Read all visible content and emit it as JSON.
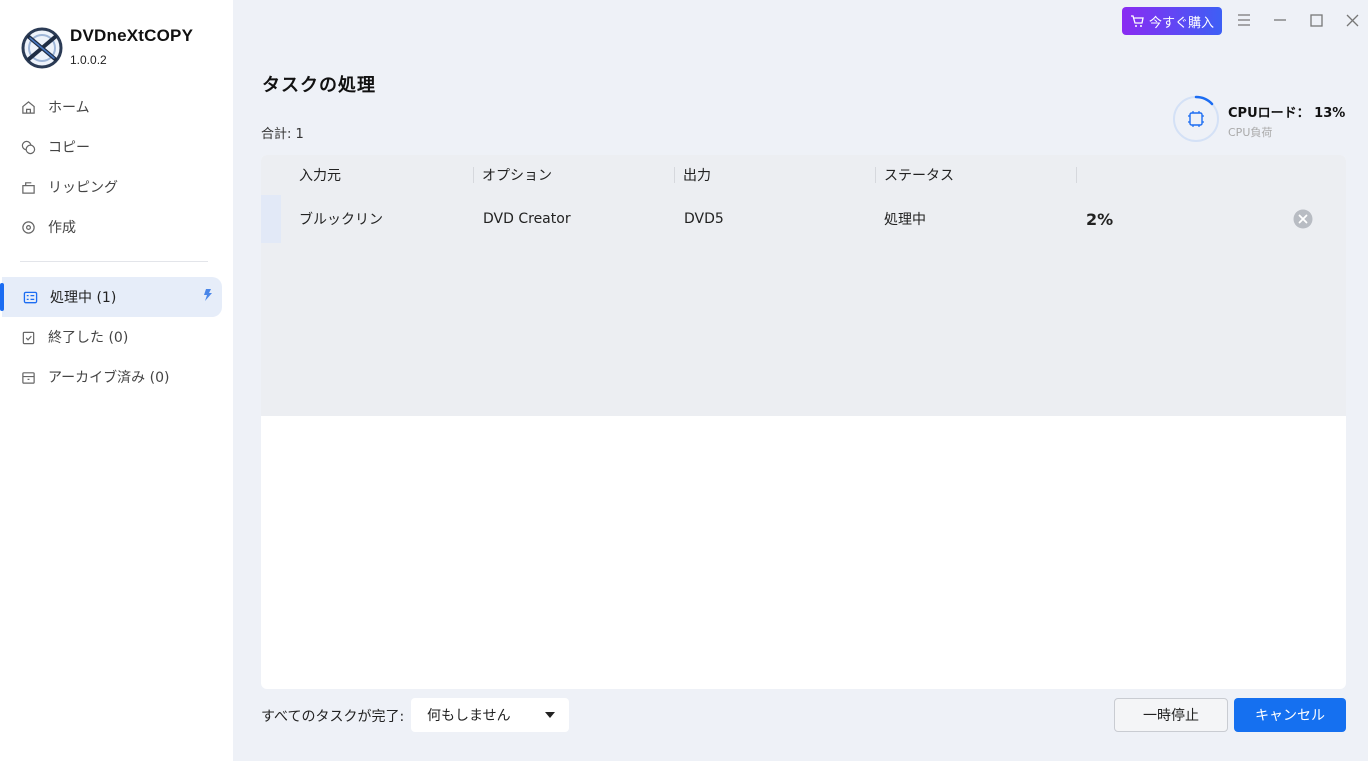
{
  "app": {
    "title": "DVDneXtCOPY",
    "version": "1.0.0.2"
  },
  "topbar": {
    "buy_label": "今すぐ購入",
    "accent_gradient": [
      "#8a2bf2",
      "#3d5ff5"
    ]
  },
  "sidebar": {
    "items": [
      {
        "label": "ホーム",
        "icon": "home-icon"
      },
      {
        "label": "コピー",
        "icon": "copy-icon"
      },
      {
        "label": "リッピング",
        "icon": "ripping-icon"
      },
      {
        "label": "作成",
        "icon": "create-icon"
      },
      {
        "label": "処理中 (1)",
        "icon": "processing-icon",
        "active": true
      },
      {
        "label": "終了した (0)",
        "icon": "finished-icon"
      },
      {
        "label": "アーカイブ済み (0)",
        "icon": "archive-icon"
      }
    ]
  },
  "main": {
    "title": "タスクの処理",
    "total": "合計: 1",
    "cpu": {
      "label": "CPUロード：",
      "value": "13%",
      "sub": "CPU負荷",
      "load_fraction": 0.13
    },
    "table": {
      "columns": [
        "入力元",
        "オプション",
        "出力",
        "ステータス"
      ],
      "rows": [
        {
          "source": "ブルックリン",
          "option": "DVD Creator",
          "output": "DVD5",
          "status": "処理中",
          "progress": "2%"
        }
      ]
    }
  },
  "footer": {
    "after_all_label": "すべてのタスクが完了:",
    "after_all_value": "何もしません",
    "pause_label": "一時停止",
    "cancel_label": "キャンセル"
  },
  "colors": {
    "primary": "#1570f0",
    "active_bg": "#e6edf9"
  }
}
